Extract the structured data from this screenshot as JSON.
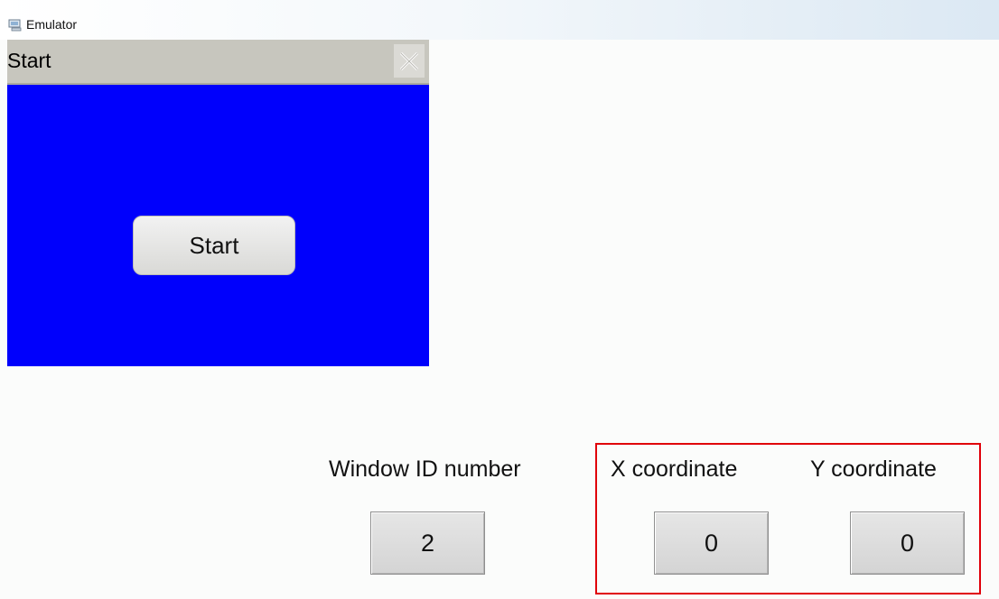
{
  "window": {
    "title": "Emulator",
    "icon": "emulator-icon"
  },
  "subwindow": {
    "title": "Start",
    "close_icon": "close-icon",
    "background_color": "#0000fc",
    "start_button_label": "Start"
  },
  "fields": {
    "window_id": {
      "label": "Window ID number",
      "value": "2"
    },
    "x_coordinate": {
      "label": "X coordinate",
      "value": "0"
    },
    "y_coordinate": {
      "label": "Y coordinate",
      "value": "0"
    }
  },
  "colors": {
    "highlight": "#e0000a",
    "header": "#c7c6be"
  }
}
